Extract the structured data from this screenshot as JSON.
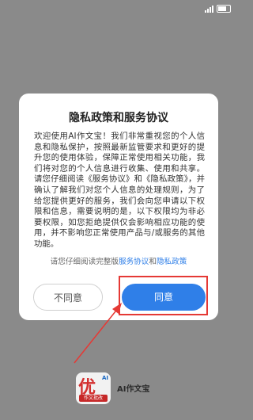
{
  "status_bar": {
    "time": "",
    "battery": ""
  },
  "dialog": {
    "title": "隐私政策和服务协议",
    "body": "欢迎使用AI作文宝！我们非常重视您的个人信息和隐私保护，按照最新监管要求和更好的提升您的使用体验，保障正常使用相关功能，我们将对您的个人信息进行收集、使用和共享。请您仔细阅读《服务协议》和《隐私政策》，并确认了解我们对您个人信息的处理规则，为了给您提供更好的服务，我们会向您申请以下权限和信息，需要说明的是，以下权限均为非必要权限，如您拒绝提供仅会影响相应功能的使用，并不影响您正常使用产品与/或服务的其他功能。",
    "link_prefix": "请您仔细阅读完整版",
    "link_service": "服务协议",
    "link_and": "和",
    "link_privacy": "隐私政策",
    "disagree_label": "不同意",
    "agree_label": "同意"
  },
  "app": {
    "logo_char": "优",
    "logo_ai": "AI",
    "logo_banner": "作文批改",
    "name": "AI作文宝"
  },
  "colors": {
    "accent": "#2f7fe8",
    "highlight": "#e53935",
    "overlay": "#8a8a8a"
  }
}
